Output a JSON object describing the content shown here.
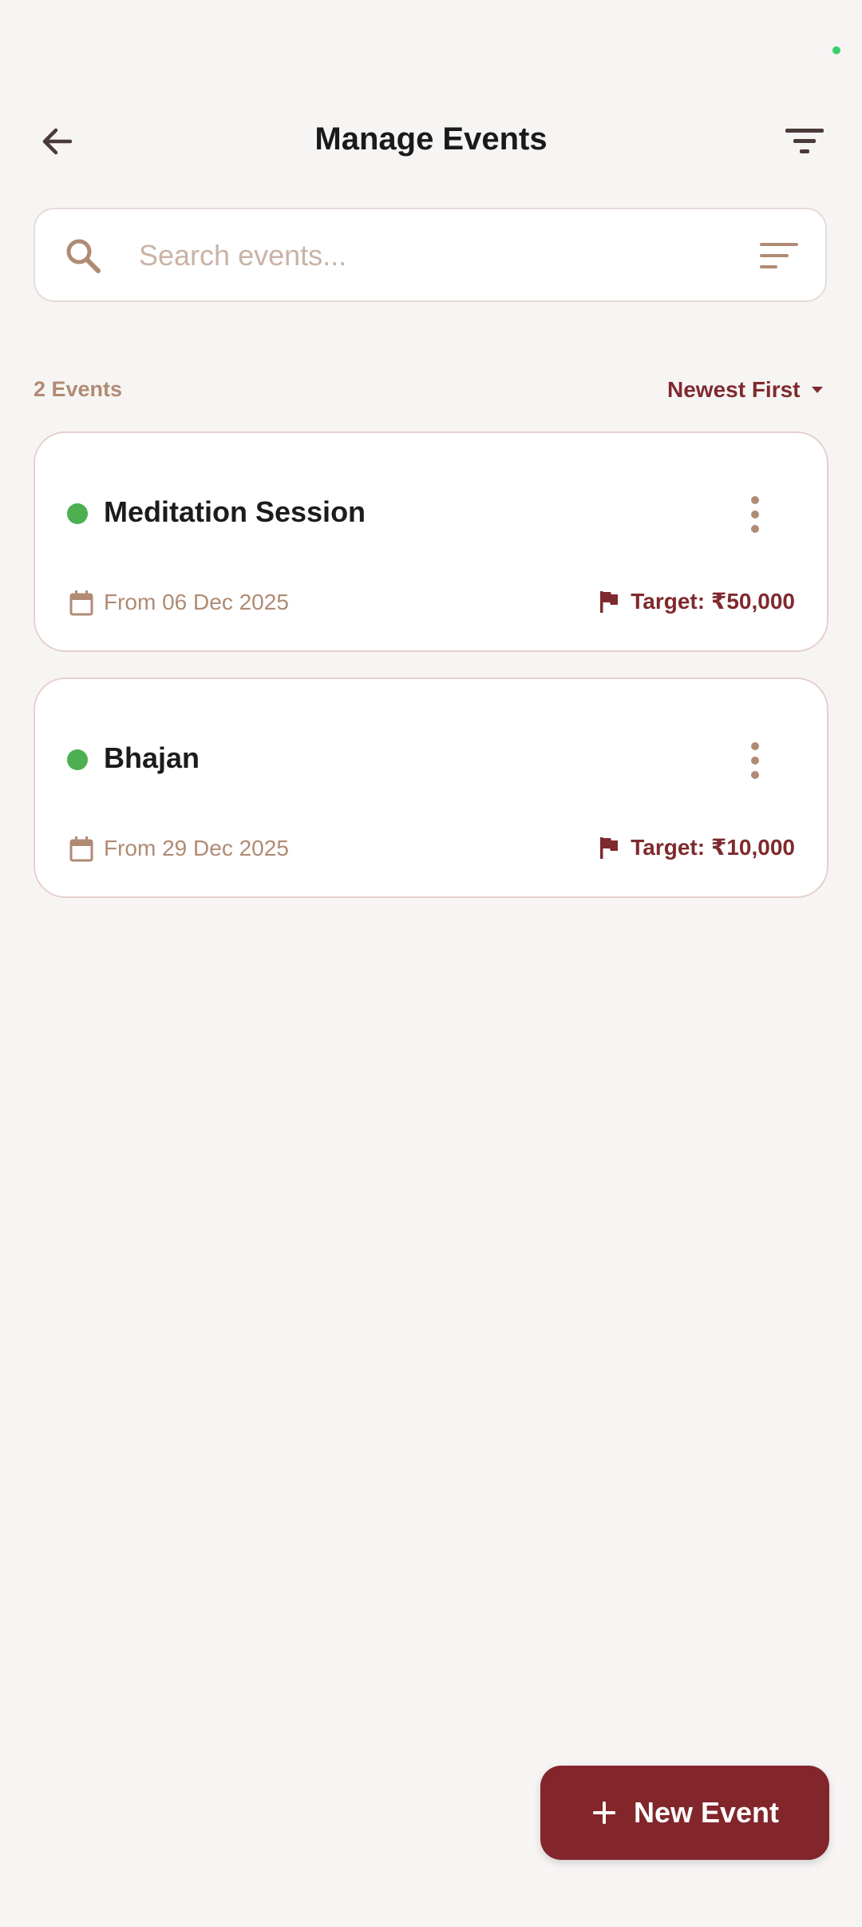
{
  "header": {
    "title": "Manage Events"
  },
  "search": {
    "placeholder": "Search events..."
  },
  "list_meta": {
    "count_label": "2 Events",
    "sort_label": "Newest First"
  },
  "events": [
    {
      "name": "Meditation Session",
      "date": "From 06 Dec 2025",
      "target": "Target: ₹50,000",
      "status": "active"
    },
    {
      "name": "Bhajan",
      "date": "From 29 Dec 2025",
      "target": "Target: ₹10,000",
      "status": "active"
    }
  ],
  "fab": {
    "label": "New Event"
  },
  "colors": {
    "accent": "#82262c",
    "muted": "#b08b74",
    "status_active": "#4caf50",
    "background": "#f7f5f4"
  },
  "icons": [
    "back-arrow-icon",
    "filter-icon",
    "search-icon",
    "sort-lines-icon",
    "more-vert-icon",
    "calendar-icon",
    "flag-icon",
    "plus-icon",
    "caret-down-icon"
  ]
}
